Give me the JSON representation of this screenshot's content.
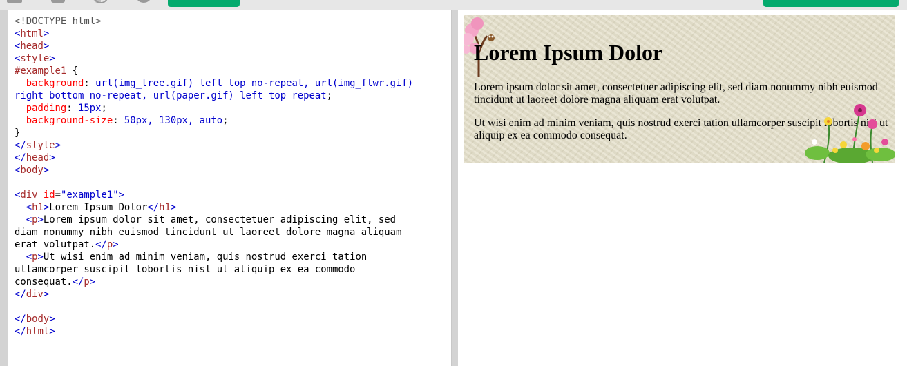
{
  "code_lines": [
    "<!DOCTYPE html>",
    "<html>",
    "<head>",
    "<style>",
    "#example1 {",
    "  background: url(img_tree.gif) left top no-repeat, url(img_flwr.gif)",
    "right bottom no-repeat, url(paper.gif) left top repeat;",
    "  padding: 15px;",
    "  background-size: 50px, 130px, auto;",
    "}",
    "</style>",
    "</head>",
    "<body>",
    "",
    "<div id=\"example1\">",
    "  <h1>Lorem Ipsum Dolor</h1>",
    "  <p>Lorem ipsum dolor sit amet, consectetuer adipiscing elit, sed",
    "diam nonummy nibh euismod tincidunt ut laoreet dolore magna aliquam",
    "erat volutpat.</p>",
    "  <p>Ut wisi enim ad minim veniam, quis nostrud exerci tation",
    "ullamcorper suscipit lobortis nisl ut aliquip ex ea commodo",
    "consequat.</p>",
    "</div>",
    "",
    "</body>",
    "</html>"
  ],
  "result": {
    "heading": "Lorem Ipsum Dolor",
    "paragraph1": "Lorem ipsum dolor sit amet, consectetuer adipiscing elit, sed diam nonummy nibh euismod tincidunt ut laoreet dolore magna aliquam erat volutpat.",
    "paragraph2": "Ut wisi enim ad minim veniam, quis nostrud exerci tation ullamcorper suscipit lobortis nisl ut aliquip ex ea commodo consequat."
  },
  "colors": {
    "run_button": "#04aa6d",
    "tag": "#a52a2a",
    "value": "#0000cd",
    "property": "#ff0000"
  }
}
